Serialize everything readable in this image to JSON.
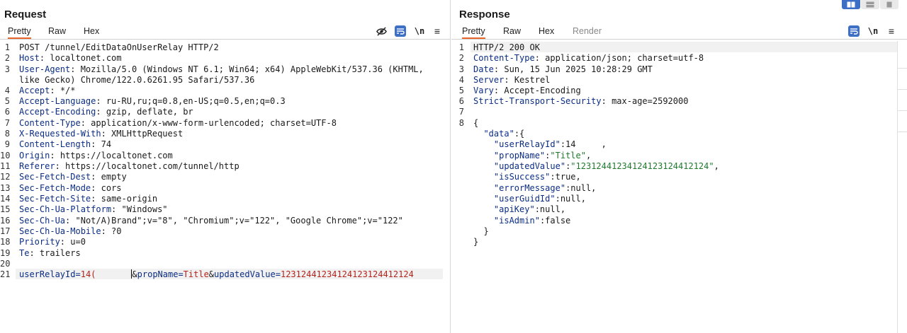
{
  "request": {
    "title": "Request",
    "tabs": [
      "Pretty",
      "Raw",
      "Hex"
    ],
    "icons": [
      "hide-icon",
      "wrap-icon",
      "newline-icon",
      "menu-icon"
    ],
    "newline_label": "\\n",
    "menu_label": "≡",
    "line_numbers": [
      "1",
      "2",
      "3",
      "",
      "4",
      "5",
      "6",
      "7",
      "8",
      "9",
      "10",
      "11",
      "12",
      "13",
      "14",
      "15",
      "16",
      "17",
      "18",
      "19",
      "20",
      "21"
    ],
    "request_line": "POST /tunnel/EditDataOnUserRelay HTTP/2",
    "headers": [
      {
        "name": "Host",
        "value": " localtonet.com"
      },
      {
        "name": "User-Agent",
        "value": " Mozilla/5.0 (Windows NT 6.1; Win64; x64) AppleWebKit/537.36 (KHTML,"
      },
      {
        "name": "",
        "value": "like Gecko) Chrome/122.0.6261.95 Safari/537.36"
      },
      {
        "name": "Accept",
        "value": " */*"
      },
      {
        "name": "Accept-Language",
        "value": " ru-RU,ru;q=0.8,en-US;q=0.5,en;q=0.3"
      },
      {
        "name": "Accept-Encoding",
        "value": " gzip, deflate, br"
      },
      {
        "name": "Content-Type",
        "value": " application/x-www-form-urlencoded; charset=UTF-8"
      },
      {
        "name": "X-Requested-With",
        "value": " XMLHttpRequest"
      },
      {
        "name": "Content-Length",
        "value": " 74"
      },
      {
        "name": "Origin",
        "value": " https://localtonet.com"
      },
      {
        "name": "Referer",
        "value": " https://localtonet.com/tunnel/http"
      },
      {
        "name": "Sec-Fetch-Dest",
        "value": " empty"
      },
      {
        "name": "Sec-Fetch-Mode",
        "value": " cors"
      },
      {
        "name": "Sec-Fetch-Site",
        "value": " same-origin"
      },
      {
        "name": "Sec-Ch-Ua-Platform",
        "value": " \"Windows\""
      },
      {
        "name": "Sec-Ch-Ua",
        "value": " \"Not/A)Brand\";v=\"8\", \"Chromium\";v=\"122\", \"Google Chrome\";v=\"122\""
      },
      {
        "name": "Sec-Ch-Ua-Mobile",
        "value": " ?0"
      },
      {
        "name": "Priority",
        "value": " u=0"
      },
      {
        "name": "Te",
        "value": " trailers"
      }
    ],
    "body": {
      "k1": "userRelayId",
      "eq1": "=",
      "v1": "14(",
      "sep1": "&",
      "k2": "propName",
      "eq2": "=",
      "v2": "Title",
      "sep2": "&",
      "k3": "updatedValue",
      "eq3": "=",
      "v3": "12312441234124123124412124"
    }
  },
  "response": {
    "title": "Response",
    "tabs": [
      "Pretty",
      "Raw",
      "Hex",
      "Render"
    ],
    "icons": [
      "wrap-icon",
      "newline-icon",
      "menu-icon"
    ],
    "newline_label": "\\n",
    "menu_label": "≡",
    "line_numbers": [
      "1",
      "2",
      "3",
      "4",
      "5",
      "6",
      "7",
      "8"
    ],
    "status_line": "HTTP/2 200 OK",
    "headers": [
      {
        "name": "Content-Type",
        "value": " application/json; charset=utf-8"
      },
      {
        "name": "Date",
        "value": " Sun, 15 Jun 2025 10:28:29 GMT"
      },
      {
        "name": "Server",
        "value": " Kestrel"
      },
      {
        "name": "Vary",
        "value": " Accept-Encoding"
      },
      {
        "name": "Strict-Transport-Security",
        "value": " max-age=2592000"
      }
    ],
    "json_lines": [
      {
        "indent": "",
        "key": "",
        "rest": "{"
      },
      {
        "indent": "  ",
        "key": "\"data\"",
        "rest": ":{"
      },
      {
        "indent": "    ",
        "key": "\"userRelayId\"",
        "rest": ":14",
        "tail": "     ,"
      },
      {
        "indent": "    ",
        "key": "\"propName\"",
        "rest": ":",
        "str": "\"Title\"",
        "after": ","
      },
      {
        "indent": "    ",
        "key": "\"updatedValue\"",
        "rest": ":",
        "str": "\"12312441234124123124412124\"",
        "after": ","
      },
      {
        "indent": "    ",
        "key": "\"isSuccess\"",
        "rest": ":true,"
      },
      {
        "indent": "    ",
        "key": "\"errorMessage\"",
        "rest": ":null,"
      },
      {
        "indent": "    ",
        "key": "\"userGuidId\"",
        "rest": ":null,"
      },
      {
        "indent": "    ",
        "key": "\"apiKey\"",
        "rest": ":null,"
      },
      {
        "indent": "    ",
        "key": "\"isAdmin\"",
        "rest": ":false"
      },
      {
        "indent": "  ",
        "key": "",
        "rest": "}"
      },
      {
        "indent": "",
        "key": "",
        "rest": "}"
      }
    ]
  },
  "layout_toggle": [
    "split-horizontal-icon",
    "split-vertical-icon",
    "single-pane-icon"
  ],
  "colors": {
    "accent_tab": "#e8662a",
    "header_name": "#0b2d84",
    "param_value": "#b4231b",
    "json_string": "#1f7a2d",
    "toggle_active": "#3d6fc6"
  }
}
